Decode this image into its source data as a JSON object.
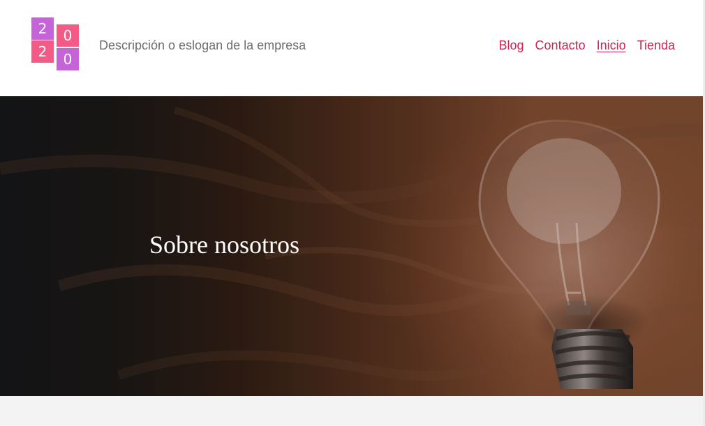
{
  "header": {
    "logo": {
      "tiles": [
        "2",
        "0",
        "2",
        "0"
      ]
    },
    "tagline": "Descripción o eslogan de la empresa",
    "nav": {
      "items": [
        {
          "label": "Blog",
          "active": false
        },
        {
          "label": "Contacto",
          "active": false
        },
        {
          "label": "Inicio",
          "active": true
        },
        {
          "label": "Tienda",
          "active": false
        }
      ]
    }
  },
  "hero": {
    "title": "Sobre nosotros",
    "image_subject": "light-bulb-on-wooden-surface-icon"
  },
  "colors": {
    "brand_pink": "#cd2653",
    "logo_purple": "#c564d8",
    "logo_coral": "#f35a86",
    "text_gray": "#6e6e6e",
    "footer_gray": "#f3f3f3"
  }
}
